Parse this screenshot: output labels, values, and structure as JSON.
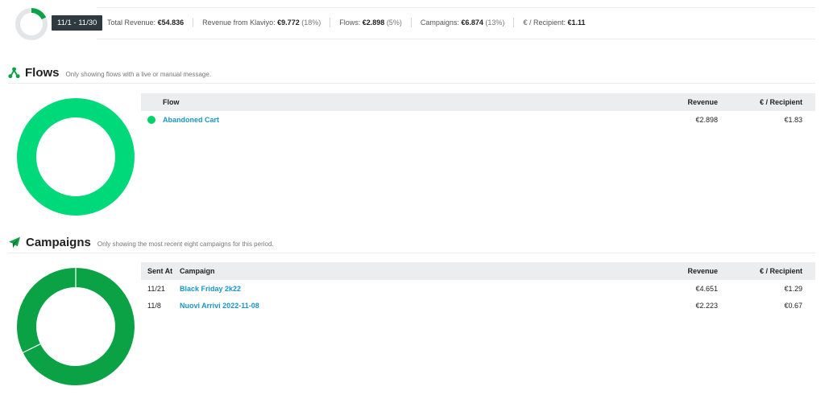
{
  "summary": {
    "date_range": "11/1 - 11/30",
    "total_revenue_label": "Total Revenue:",
    "total_revenue": "€54.836",
    "klaviyo_label": "Revenue from Klaviyo:",
    "klaviyo_value": "€9.772",
    "klaviyo_pct": "(18%)",
    "flows_label": "Flows:",
    "flows_value": "€2.898",
    "flows_pct": "(5%)",
    "campaigns_label": "Campaigns:",
    "campaigns_value": "€6.874",
    "campaigns_pct": "(13%)",
    "per_recipient_label": "€ / Recipient:",
    "per_recipient_value": "€1.11",
    "klaviyo_share": 0.18
  },
  "flows": {
    "title": "Flows",
    "note": "Only showing flows with a live or manual message.",
    "columns": {
      "flow": "Flow",
      "revenue": "Revenue",
      "per_recipient": "€ / Recipient"
    },
    "rows": [
      {
        "name": "Abandoned Cart",
        "revenue": "€2.898",
        "per_recipient": "€1.83",
        "share": 1.0
      }
    ]
  },
  "campaigns": {
    "title": "Campaigns",
    "note": "Only showing the most recent eight campaigns for this period.",
    "columns": {
      "sent_at": "Sent At",
      "campaign": "Campaign",
      "revenue": "Revenue",
      "per_recipient": "€ / Recipient"
    },
    "rows": [
      {
        "sent_at": "11/21",
        "name": "Black Friday 2k22",
        "revenue": "€4.651",
        "per_recipient": "€1.29",
        "share": 0.677
      },
      {
        "sent_at": "11/8",
        "name": "Nuovi Arrivi 2022-11-08",
        "revenue": "€2.223",
        "per_recipient": "€0.67",
        "share": 0.323
      }
    ]
  },
  "colors": {
    "flow_green": "#00d97a",
    "campaign_green": "#0aa244",
    "donut_gray": "#e3e5e7",
    "link_blue": "#1996c8"
  }
}
